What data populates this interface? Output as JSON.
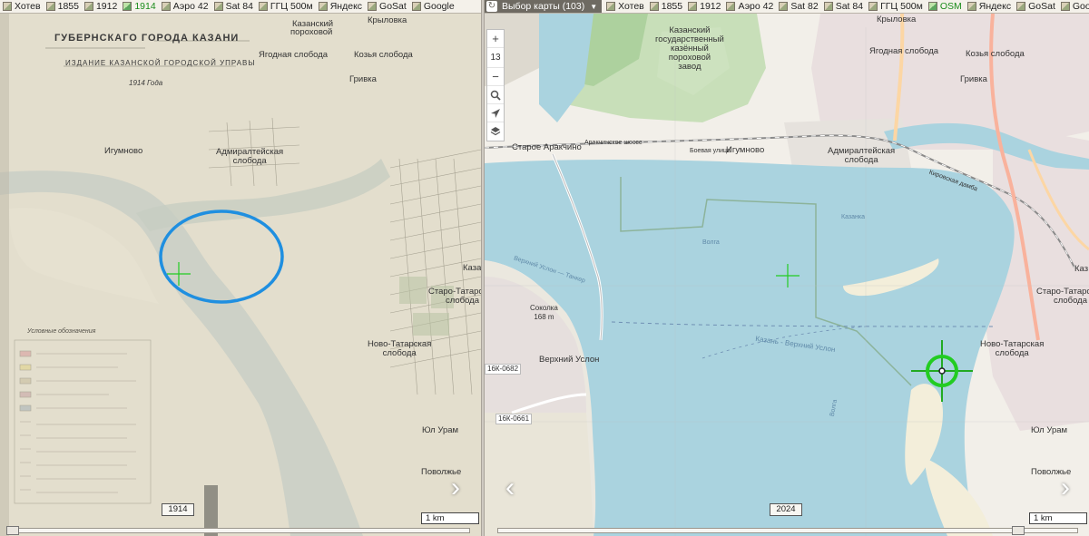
{
  "left": {
    "layers": [
      {
        "icon": "map-thumb-icon",
        "label": "Хотев",
        "active": false
      },
      {
        "icon": "map-thumb-icon",
        "label": "1855",
        "active": false
      },
      {
        "icon": "map-thumb-icon",
        "label": "1912",
        "active": false
      },
      {
        "icon": "map-thumb-icon",
        "label": "1914",
        "active": true
      },
      {
        "icon": "map-thumb-icon",
        "label": "Аэро 42",
        "active": false
      },
      {
        "icon": "map-thumb-icon",
        "label": "Sat 84",
        "active": false
      },
      {
        "icon": "map-thumb-icon",
        "label": "ГГЦ 500м",
        "active": false
      },
      {
        "icon": "map-thumb-icon",
        "label": "Яндекс",
        "active": false
      },
      {
        "icon": "map-thumb-icon",
        "label": "GoSat",
        "active": false
      },
      {
        "icon": "map-thumb-icon",
        "label": "Google",
        "active": false
      }
    ],
    "map_title_line1": "ГУБЕРНСКАГО ГОРОДА КАЗАНИ",
    "map_title_line2": "ИЗДАНИЕ КАЗАНСКОЙ ГОРОДСКОЙ УПРАВЫ",
    "map_year_script": "1914 Года",
    "labels": {
      "kazansky": "Казанский",
      "porokhovoy": "пороховой",
      "krylovka": "Крыловка",
      "yagodnaya": "Ягодная слобода",
      "kozya": "Козья слобода",
      "grivka": "Гривка",
      "igumnovo": "Игумново",
      "admiralteyskaya": "Адмиралтейская\nслобода",
      "kazan": "Казань",
      "staro": "Старо-Татарская\nслобода",
      "novo": "Ново-Татарская\nслобода",
      "yulural": "Юл Урам",
      "povolzhye": "Поволжье",
      "legend_title": "Условные обозначения"
    },
    "year_badge": "1914",
    "scale": "1 km",
    "next_arrow": "›"
  },
  "right": {
    "map_select": "Выбор карты (103)",
    "layers": [
      {
        "icon": "map-thumb-icon",
        "label": "Хотев",
        "active": false
      },
      {
        "icon": "map-thumb-icon",
        "label": "1855",
        "active": false
      },
      {
        "icon": "map-thumb-icon",
        "label": "1912",
        "active": false
      },
      {
        "icon": "map-thumb-icon",
        "label": "Аэро 42",
        "active": false
      },
      {
        "icon": "map-thumb-icon",
        "label": "Sat 82",
        "active": false
      },
      {
        "icon": "map-thumb-icon",
        "label": "Sat 84",
        "active": false
      },
      {
        "icon": "map-thumb-icon",
        "label": "ГГЦ 500м",
        "active": false
      },
      {
        "icon": "map-thumb-icon",
        "label": "OSM",
        "active": true
      },
      {
        "icon": "map-thumb-icon",
        "label": "Яндекс",
        "active": false
      },
      {
        "icon": "map-thumb-icon",
        "label": "GoSat",
        "active": false
      },
      {
        "icon": "map-thumb-icon",
        "label": "Google",
        "active": false
      }
    ],
    "zoom_in": "+",
    "zoom_level": "13",
    "zoom_out": "−",
    "labels": {
      "factory": "Казанский\nгосударственный\nказённый\nпороховой\nзавод",
      "krylovka": "Крыловка",
      "yagodnaya": "Ягодная слобода",
      "kozya": "Козья слобода",
      "grivka": "Гривка",
      "staroe_arakchino": "Старое Аракчино",
      "arakchinskoe_shosse": "Аракчинское шоссе",
      "boevaya": "Боевая улица",
      "igumnovo": "Игумново",
      "admiralteyskaya": "Адмиралтейская\nслобода",
      "volga": "Волга",
      "kazanka": "Казанка",
      "verkhny_uslon_river": "Верхний Услон — Танкер",
      "sokolka": "Соколка\n168 m",
      "verkhny_uslon": "Верхний Услон",
      "road1": "16К-0682",
      "road2": "16К-0661",
      "ferry": "Казань - Верхний Услон",
      "volga2": "Волга",
      "kirovskaya": "Кировская дамба",
      "kaz": "Каз",
      "staro": "Старо-Татарская\nслобода",
      "novo": "Ново-Татарская\nслобода",
      "yulural": "Юл Урам",
      "povolzhye": "Поволжье"
    },
    "year_badge": "2024",
    "scale": "1 km",
    "prev_arrow": "‹",
    "next_arrow": "›"
  },
  "colors": {
    "water": "#aad3df",
    "land": "#f2efe9",
    "forest": "#add19e",
    "old_paper": "#ded9c6",
    "old_water": "#c9cfc5",
    "marker_green": "#22cc22",
    "circle_blue": "#1f8fe0",
    "active_layer": "#1b8c1b"
  }
}
